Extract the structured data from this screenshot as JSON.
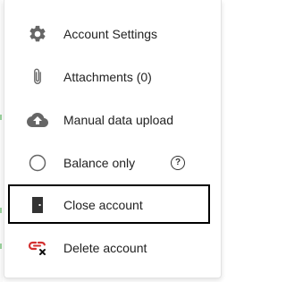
{
  "menu": {
    "items": [
      {
        "label": "Account Settings",
        "icon": "gear-icon"
      },
      {
        "label": "Attachments (0)",
        "icon": "paperclip-icon"
      },
      {
        "label": "Manual data upload",
        "icon": "cloud-upload-icon"
      },
      {
        "label": "Balance only",
        "icon": "radio-empty-icon",
        "help": "?"
      },
      {
        "label": "Close account",
        "icon": "door-icon"
      },
      {
        "label": "Delete account",
        "icon": "unlink-delete-icon"
      }
    ]
  },
  "colors": {
    "icon_gray": "#666666",
    "text": "#222222",
    "delete_red": "#d32f2f",
    "highlight_border": "#000000"
  }
}
